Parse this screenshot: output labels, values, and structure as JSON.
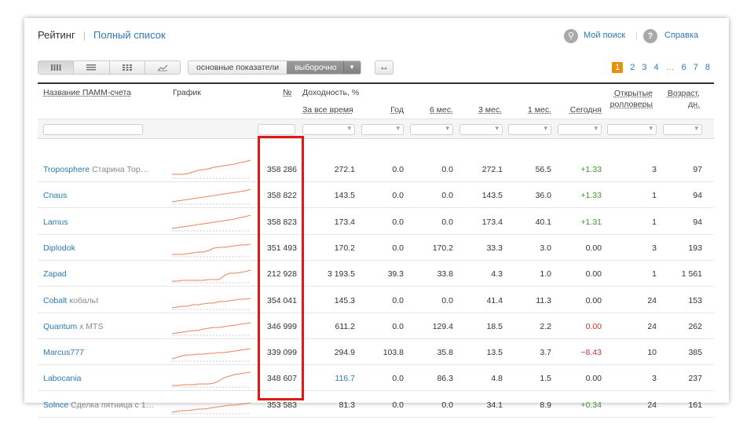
{
  "header": {
    "title": "Рейтинг",
    "separator": "|",
    "full_list_link": "Полный список",
    "my_search": "Мой поиск",
    "help": "Справка",
    "search_icon_glyph": "🔍",
    "help_icon_glyph": "?"
  },
  "toolbar": {
    "view_icons": [
      "grid-large-icon",
      "list-icon",
      "grid-small-icon",
      "chart-icon"
    ],
    "segment_main": "основные показатели",
    "segment_selected": "выборочно",
    "expand_glyph": "↔",
    "pages": [
      "1",
      "2",
      "3",
      "4",
      "…",
      "6",
      "7",
      "8"
    ],
    "current_page": "1"
  },
  "columns": {
    "name": "Название ПАММ-счета",
    "chart": "График",
    "number": "№",
    "yield_group": "Доходность, %",
    "all_time": "За все время",
    "year": "Год",
    "m6": "6 мес.",
    "m3": "3 мес.",
    "m1": "1 мес.",
    "today": "Сегодня",
    "rollovers": "Открытые ролловеры",
    "age": "Возраст, дн."
  },
  "rows": [
    {
      "name": "Troposphere",
      "extra": "Старина Тор…",
      "num": "358 286",
      "all": "272.1",
      "year": "0.0",
      "m6": "0.0",
      "m3": "272.1",
      "m1": "56.5",
      "today": "+1.33",
      "today_kind": "pos",
      "roll": "3",
      "age": "97",
      "spark": [
        5,
        5,
        5,
        6,
        8,
        10,
        11,
        12,
        14,
        15,
        16,
        17,
        18,
        20,
        21,
        23
      ]
    },
    {
      "name": "Cnaus",
      "extra": "",
      "num": "358 822",
      "all": "143.5",
      "year": "0.0",
      "m6": "0.0",
      "m3": "143.5",
      "m1": "36.0",
      "today": "+1.33",
      "today_kind": "pos",
      "roll": "1",
      "age": "94",
      "spark": [
        3,
        4,
        5,
        6,
        7,
        8,
        9,
        10,
        11,
        12,
        13,
        14,
        15,
        16,
        17,
        19
      ]
    },
    {
      "name": "Lamus",
      "extra": "",
      "num": "358 823",
      "all": "173.4",
      "year": "0.0",
      "m6": "0.0",
      "m3": "173.4",
      "m1": "40.1",
      "today": "+1.31",
      "today_kind": "pos",
      "roll": "1",
      "age": "94",
      "spark": [
        3,
        4,
        5,
        6,
        7,
        8,
        9,
        10,
        11,
        12,
        13,
        14,
        15,
        17,
        18,
        20
      ]
    },
    {
      "name": "Diplodok",
      "extra": "",
      "num": "351 493",
      "all": "170.2",
      "year": "0.0",
      "m6": "170.2",
      "m3": "33.3",
      "m1": "3.0",
      "today": "0.00",
      "today_kind": "plain",
      "roll": "3",
      "age": "193",
      "spark": [
        3,
        3,
        3,
        4,
        5,
        6,
        6,
        8,
        11,
        12,
        12,
        13,
        14,
        15,
        15,
        16
      ]
    },
    {
      "name": "Zapad",
      "extra": "",
      "num": "212 928",
      "all": "3 193.5",
      "year": "39.3",
      "m6": "33.8",
      "m3": "4.3",
      "m1": "1.0",
      "today": "0.00",
      "today_kind": "plain",
      "roll": "1",
      "age": "1 561",
      "spark": [
        2,
        2,
        3,
        3,
        3,
        3,
        3,
        4,
        4,
        4,
        9,
        12,
        12,
        13,
        14,
        16
      ]
    },
    {
      "name": "Cobalt",
      "extra": "кобальт",
      "num": "354 041",
      "all": "145.3",
      "year": "0.0",
      "m6": "0.0",
      "m3": "41.4",
      "m1": "11.3",
      "today": "0.00",
      "today_kind": "plain",
      "roll": "24",
      "age": "153",
      "spark": [
        2,
        3,
        4,
        4,
        6,
        6,
        7,
        8,
        8,
        10,
        10,
        11,
        12,
        13,
        13,
        14
      ]
    },
    {
      "name": "Quantum",
      "extra": "x MTS",
      "num": "346 999",
      "all": "611.2",
      "year": "0.0",
      "m6": "129.4",
      "m3": "18.5",
      "m1": "2.2",
      "today": "0.00",
      "today_kind": "neg",
      "roll": "24",
      "age": "262",
      "spark": [
        2,
        3,
        4,
        5,
        6,
        6,
        8,
        9,
        10,
        10,
        11,
        12,
        13,
        14,
        15,
        16
      ]
    },
    {
      "name": "Marcus777",
      "extra": "",
      "num": "339 099",
      "all": "294.9",
      "year": "103.8",
      "m6": "35.8",
      "m3": "13.5",
      "m1": "3.7",
      "today": "−8.43",
      "today_kind": "neg",
      "roll": "10",
      "age": "385",
      "spark": [
        3,
        5,
        7,
        8,
        8,
        9,
        9,
        10,
        10,
        11,
        11,
        12,
        13,
        14,
        15,
        16
      ]
    },
    {
      "name": "Labocania",
      "extra": "",
      "num": "348 607",
      "all": "116.7",
      "year": "0.0",
      "m6": "86.3",
      "m3": "4.8",
      "m1": "1.5",
      "today": "0.00",
      "today_kind": "plain",
      "roll": "3",
      "age": "237",
      "spark": [
        2,
        2,
        3,
        3,
        3,
        4,
        4,
        4,
        5,
        8,
        12,
        14,
        16,
        17,
        18,
        19
      ],
      "all_kind": "blue"
    },
    {
      "name": "Solnce",
      "extra": "Сделка пятница с 1…",
      "num": "353 583",
      "all": "81.3",
      "year": "0.0",
      "m6": "0.0",
      "m3": "34.1",
      "m1": "8.9",
      "today": "+0.34",
      "today_kind": "pos",
      "roll": "24",
      "age": "161",
      "spark": [
        2,
        3,
        4,
        4,
        5,
        6,
        6,
        7,
        8,
        9,
        10,
        11,
        11,
        12,
        13,
        14
      ]
    }
  ],
  "colors": {
    "link": "#2a7ab8",
    "positive": "#3a9a2a",
    "negative": "#c0392b",
    "spark": "#e8825a",
    "highlight": "#e01818",
    "page_active": "#e8900a"
  }
}
